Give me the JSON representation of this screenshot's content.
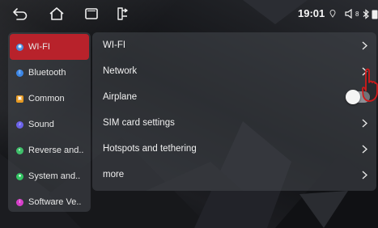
{
  "statusbar": {
    "back_icon": "back-arrow-icon",
    "home_icon": "home-icon",
    "recents_icon": "recents-icon",
    "screen_icon": "screen-cast-icon",
    "time": "19:01",
    "icons": [
      "gps-icon",
      "volume-icon",
      "bluetooth-icon",
      "battery-icon"
    ],
    "volume_level": "8"
  },
  "sidebar": {
    "items": [
      {
        "label": "WI-FI",
        "color": "#4a8fe0",
        "active": true
      },
      {
        "label": "Bluetooth",
        "color": "#3b86e6",
        "active": false
      },
      {
        "label": "Common",
        "color": "#e79a23",
        "active": false
      },
      {
        "label": "Sound",
        "color": "#6b62e8",
        "active": false
      },
      {
        "label": "Reverse and..",
        "color": "#3fbf6a",
        "active": false
      },
      {
        "label": "System and..",
        "color": "#33c463",
        "active": false
      },
      {
        "label": "Software Ve..",
        "color": "#d63fc9",
        "active": false
      }
    ]
  },
  "main": {
    "rows": [
      {
        "label": "WI-FI",
        "control": "chevron"
      },
      {
        "label": "Network",
        "control": "chevron"
      },
      {
        "label": "Airplane",
        "control": "toggle",
        "toggle_on": false
      },
      {
        "label": "SIM card settings",
        "control": "chevron"
      },
      {
        "label": "Hotspots and tethering",
        "control": "chevron"
      },
      {
        "label": "more",
        "control": "chevron"
      }
    ]
  },
  "colors": {
    "accent": "#b8222b",
    "panel": "#46484e",
    "pointer": "#d11a1a"
  }
}
